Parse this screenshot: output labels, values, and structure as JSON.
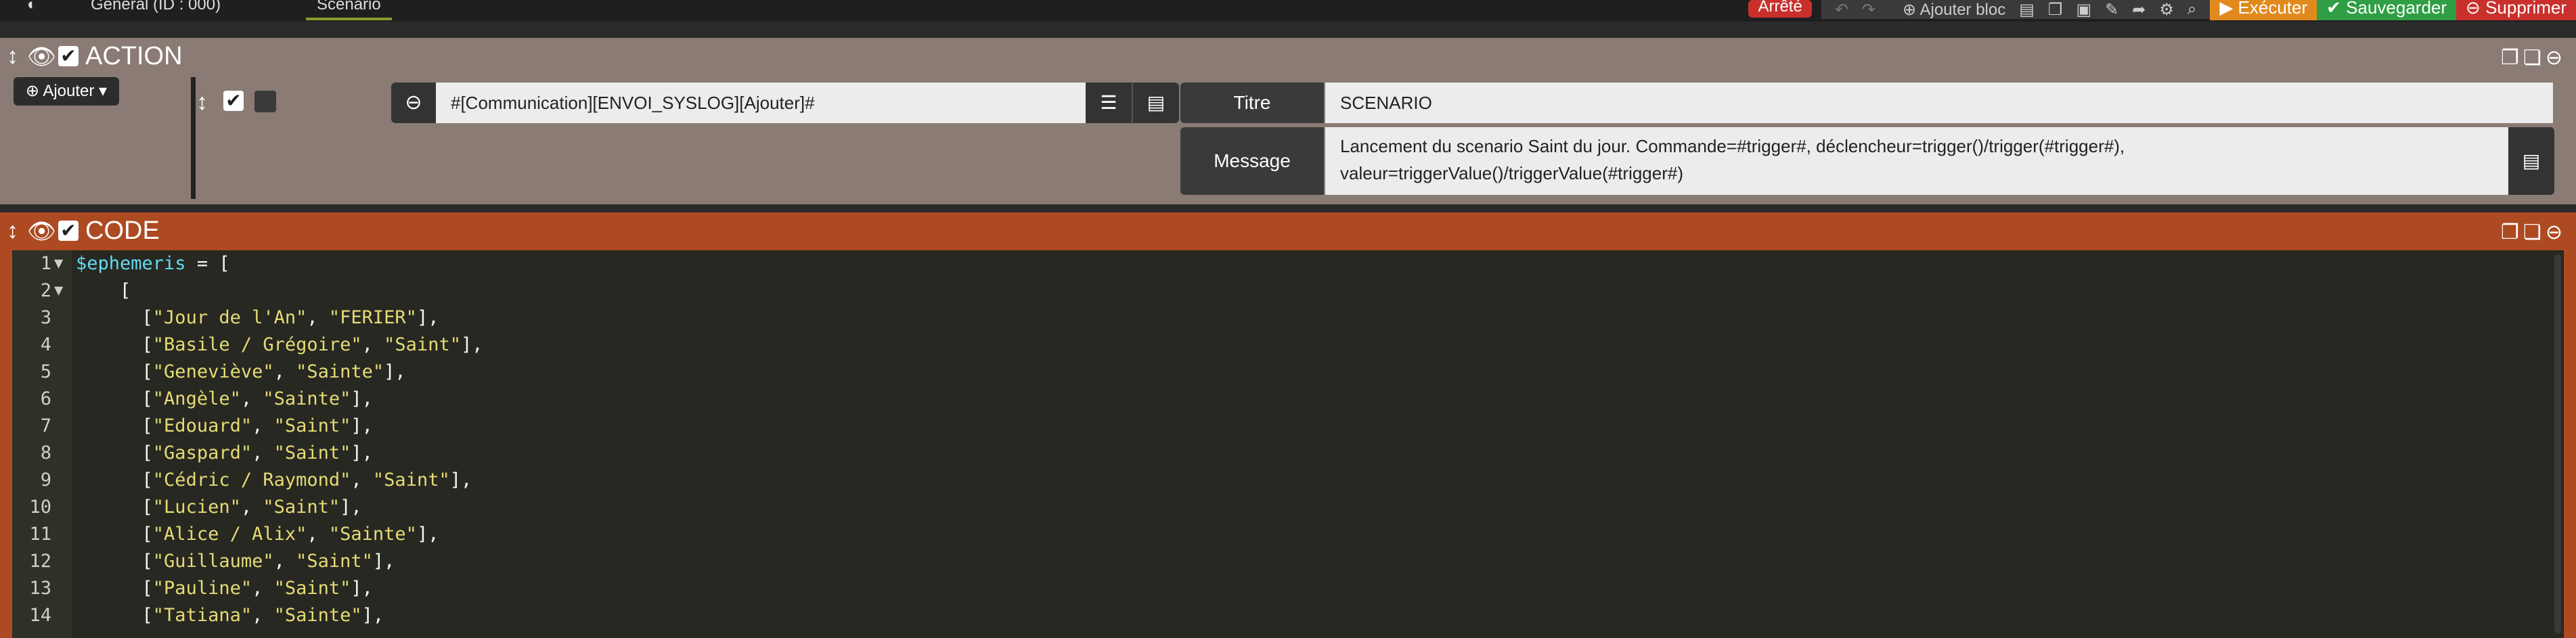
{
  "topbar": {
    "tab_general": "Général (ID : 000)",
    "tab_scenario": "Scénario",
    "status_badge": "Arrêté",
    "add_block": "Ajouter bloc",
    "execute": "Exécuter",
    "save": "Sauvegarder",
    "delete": "Supprimer",
    "colors": {
      "execute": "#e08a1e",
      "save": "#2f9e44",
      "delete": "#c9302c"
    }
  },
  "action_block": {
    "title": "ACTION",
    "add_label": "Ajouter",
    "command": "#[Communication][ENVOI_SYSLOG][Ajouter]#",
    "options": [
      {
        "label": "Titre",
        "value": "SCENARIO"
      },
      {
        "label": "Message",
        "line1": "Lancement du scenario Saint du jour. Commande=#trigger#, déclencheur=trigger()/trigger(#trigger#),",
        "line2": "valeur=triggerValue()/triggerValue(#trigger#)"
      }
    ],
    "background": "#8a7b74"
  },
  "code_block": {
    "title": "CODE",
    "background": "#ad4a21",
    "lines": [
      {
        "n": "1",
        "fold": "▼",
        "parts": [
          [
            "var",
            "$ephemeris"
          ],
          [
            "plain",
            " = ["
          ]
        ]
      },
      {
        "n": "2",
        "fold": "▼",
        "parts": [
          [
            "plain",
            "    ["
          ]
        ]
      },
      {
        "n": "3",
        "fold": "",
        "parts": [
          [
            "plain",
            "      ["
          ],
          [
            "str",
            "\"Jour de l'An\""
          ],
          [
            "plain",
            ", "
          ],
          [
            "str",
            "\"FERIER\""
          ],
          [
            "plain",
            "],"
          ]
        ]
      },
      {
        "n": "4",
        "fold": "",
        "parts": [
          [
            "plain",
            "      ["
          ],
          [
            "str",
            "\"Basile / Grégoire\""
          ],
          [
            "plain",
            ", "
          ],
          [
            "str",
            "\"Saint\""
          ],
          [
            "plain",
            "],"
          ]
        ]
      },
      {
        "n": "5",
        "fold": "",
        "parts": [
          [
            "plain",
            "      ["
          ],
          [
            "str",
            "\"Geneviève\""
          ],
          [
            "plain",
            ", "
          ],
          [
            "str",
            "\"Sainte\""
          ],
          [
            "plain",
            "],"
          ]
        ]
      },
      {
        "n": "6",
        "fold": "",
        "parts": [
          [
            "plain",
            "      ["
          ],
          [
            "str",
            "\"Angèle\""
          ],
          [
            "plain",
            ", "
          ],
          [
            "str",
            "\"Sainte\""
          ],
          [
            "plain",
            "],"
          ]
        ]
      },
      {
        "n": "7",
        "fold": "",
        "parts": [
          [
            "plain",
            "      ["
          ],
          [
            "str",
            "\"Edouard\""
          ],
          [
            "plain",
            ", "
          ],
          [
            "str",
            "\"Saint\""
          ],
          [
            "plain",
            "],"
          ]
        ]
      },
      {
        "n": "8",
        "fold": "",
        "parts": [
          [
            "plain",
            "      ["
          ],
          [
            "str",
            "\"Gaspard\""
          ],
          [
            "plain",
            ", "
          ],
          [
            "str",
            "\"Saint\""
          ],
          [
            "plain",
            "],"
          ]
        ]
      },
      {
        "n": "9",
        "fold": "",
        "parts": [
          [
            "plain",
            "      ["
          ],
          [
            "str",
            "\"Cédric / Raymond\""
          ],
          [
            "plain",
            ", "
          ],
          [
            "str",
            "\"Saint\""
          ],
          [
            "plain",
            "],"
          ]
        ]
      },
      {
        "n": "10",
        "fold": "",
        "parts": [
          [
            "plain",
            "      ["
          ],
          [
            "str",
            "\"Lucien\""
          ],
          [
            "plain",
            ", "
          ],
          [
            "str",
            "\"Saint\""
          ],
          [
            "plain",
            "],"
          ]
        ]
      },
      {
        "n": "11",
        "fold": "",
        "parts": [
          [
            "plain",
            "      ["
          ],
          [
            "str",
            "\"Alice / Alix\""
          ],
          [
            "plain",
            ", "
          ],
          [
            "str",
            "\"Sainte\""
          ],
          [
            "plain",
            "],"
          ]
        ]
      },
      {
        "n": "12",
        "fold": "",
        "parts": [
          [
            "plain",
            "      ["
          ],
          [
            "str",
            "\"Guillaume\""
          ],
          [
            "plain",
            ", "
          ],
          [
            "str",
            "\"Saint\""
          ],
          [
            "plain",
            "],"
          ]
        ]
      },
      {
        "n": "13",
        "fold": "",
        "parts": [
          [
            "plain",
            "      ["
          ],
          [
            "str",
            "\"Pauline\""
          ],
          [
            "plain",
            ", "
          ],
          [
            "str",
            "\"Saint\""
          ],
          [
            "plain",
            "],"
          ]
        ]
      },
      {
        "n": "14",
        "fold": "",
        "parts": [
          [
            "plain",
            "      ["
          ],
          [
            "str",
            "\"Tatiana\""
          ],
          [
            "plain",
            ", "
          ],
          [
            "str",
            "\"Sainte\""
          ],
          [
            "plain",
            "],"
          ]
        ]
      }
    ]
  }
}
